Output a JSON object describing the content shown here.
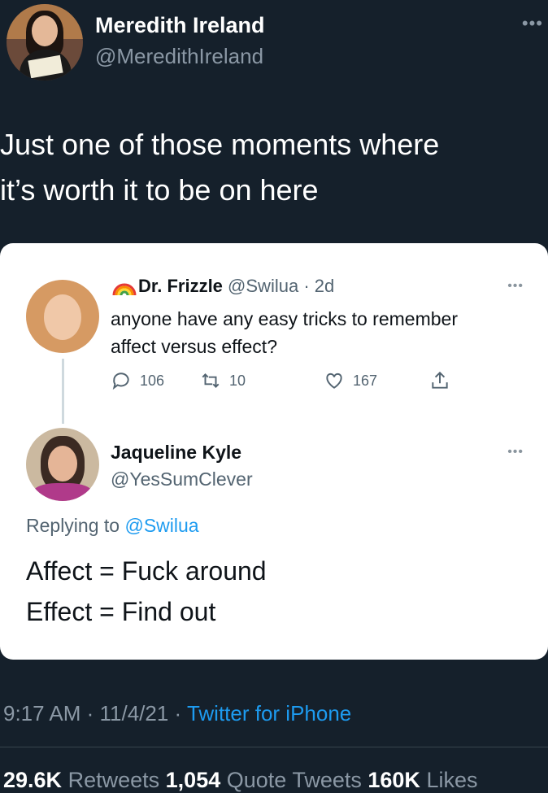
{
  "author": {
    "name": "Meredith Ireland",
    "handle": "@MeredithIreland"
  },
  "tweet": {
    "line1": "Just one of those moments where",
    "line2": "it’s worth it to be on here"
  },
  "quoted": {
    "name": "Dr. Frizzle",
    "handle": "@Swilua",
    "age": "· 2d",
    "text_line1": "anyone have any easy tricks to remember",
    "text_line2": "affect versus effect?",
    "replies": "106",
    "retweets": "10",
    "likes": "167"
  },
  "reply": {
    "name": "Jaqueline Kyle",
    "handle": "@YesSumClever",
    "replying_prefix": "Replying to",
    "replying_to": "@Swilua",
    "line1": "Affect = Fuck around",
    "line2": "Effect = Find out"
  },
  "meta": {
    "time_date": "9:17 AM · 11/4/21 · ",
    "source": "Twitter for iPhone"
  },
  "stats": {
    "retweets_count": "29.6K",
    "retweets_label": "Retweets",
    "quotes_count": "1,054",
    "quotes_label": "Quote Tweets",
    "likes_count": "160K",
    "likes_label": "Likes"
  },
  "colors": {
    "background": "#15202b",
    "accent": "#1d9bf0",
    "muted": "#8b98a5"
  }
}
